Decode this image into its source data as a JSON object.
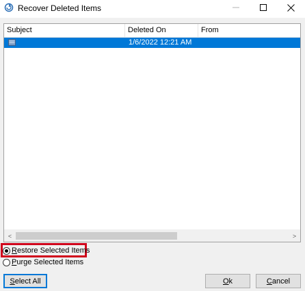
{
  "window": {
    "title": "Recover Deleted Items",
    "controls": {
      "minimize": "—",
      "maximize": "☐",
      "close": "✕"
    }
  },
  "list": {
    "columns": [
      "Subject",
      "Deleted On",
      "From"
    ],
    "rows": [
      {
        "subject": "",
        "deleted_on": "1/6/2022 12:21 AM",
        "from": "",
        "selected": true
      }
    ],
    "scroll_left_arrow": "<",
    "scroll_right_arrow": ">"
  },
  "options": {
    "restore_label": "Restore Selected Items",
    "purge_label": "Purge Selected Items",
    "selected": "restore"
  },
  "buttons": {
    "select_all": "Select All",
    "ok": "Ok",
    "cancel": "Cancel"
  },
  "colors": {
    "selection": "#0078d7",
    "highlight_box": "#d0021b",
    "focus_border": "#0078d7"
  }
}
